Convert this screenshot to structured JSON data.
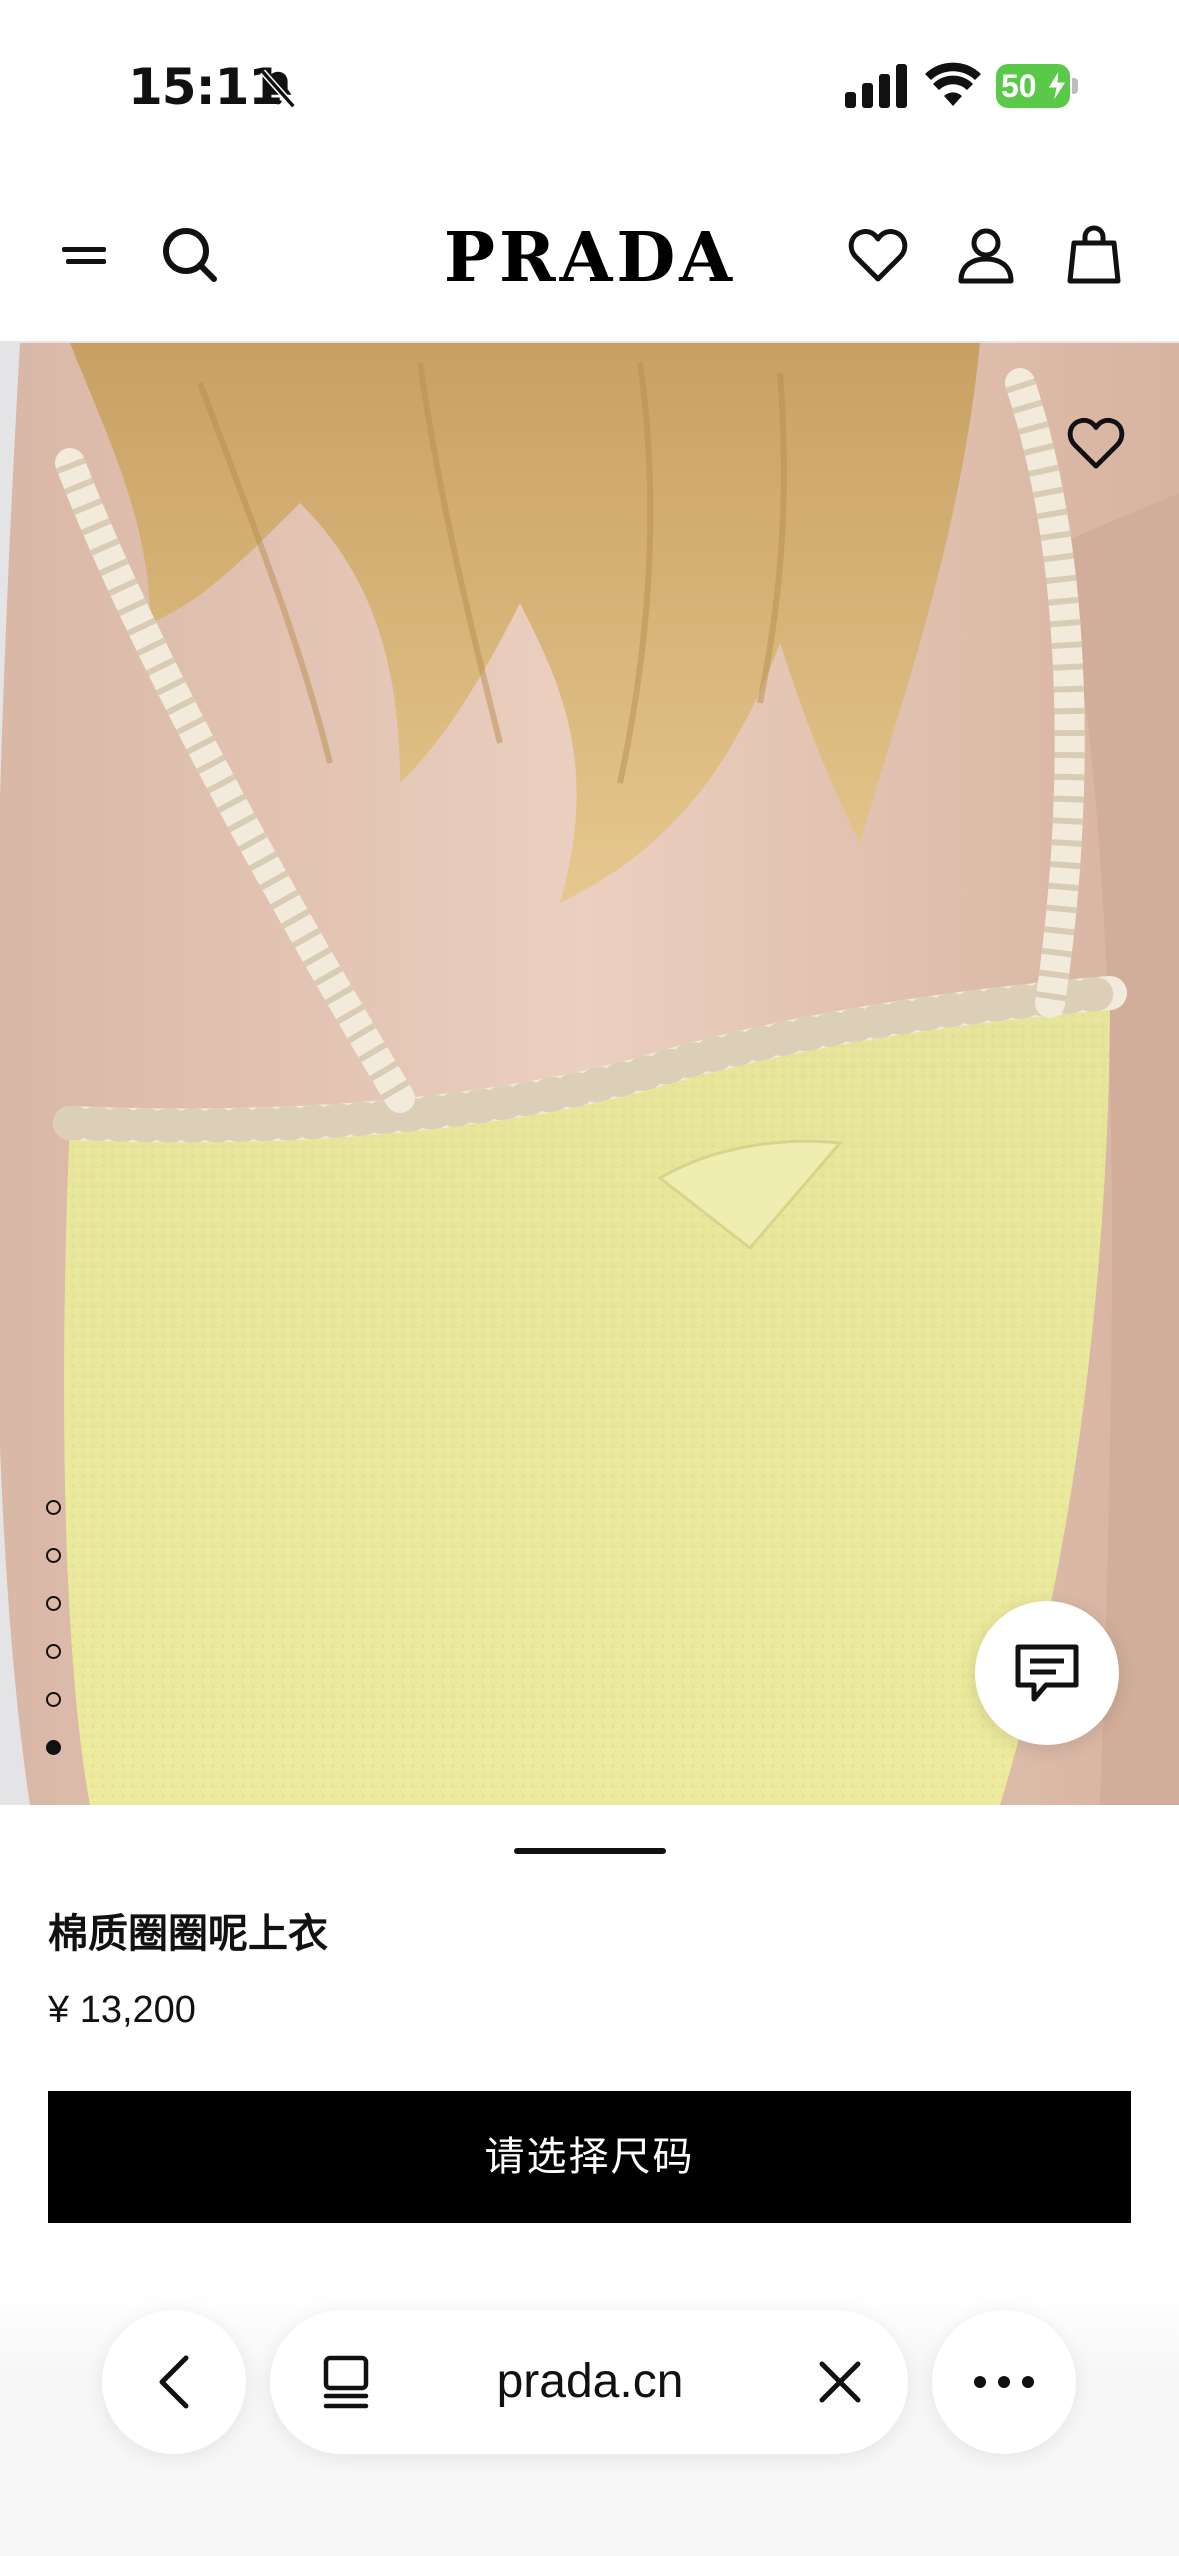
{
  "status_bar": {
    "time": "15:11",
    "battery_level": "50",
    "icons": [
      "bell-slash-icon",
      "cellular-signal-icon",
      "wifi-icon",
      "battery-charging-icon"
    ]
  },
  "header": {
    "brand": "PRADA",
    "icons": [
      "menu-icon",
      "search-icon",
      "heart-icon",
      "account-icon",
      "shopping-bag-icon"
    ]
  },
  "gallery": {
    "image_count": 6,
    "active_index": 5,
    "icons": [
      "heart-icon",
      "chat-icon"
    ]
  },
  "product": {
    "name": "棉质圈圈呢上衣",
    "price": "¥ 13,200",
    "cta_label": "请选择尺码"
  },
  "browser": {
    "url": "prada.cn",
    "icons": [
      "chevron-left-icon",
      "tabs-icon",
      "close-icon",
      "more-icon"
    ]
  },
  "colors": {
    "accent": "#000000",
    "battery": "#5ac94a",
    "knit_yellow": "#e8e79a",
    "trim_cream": "#f2eadb"
  }
}
